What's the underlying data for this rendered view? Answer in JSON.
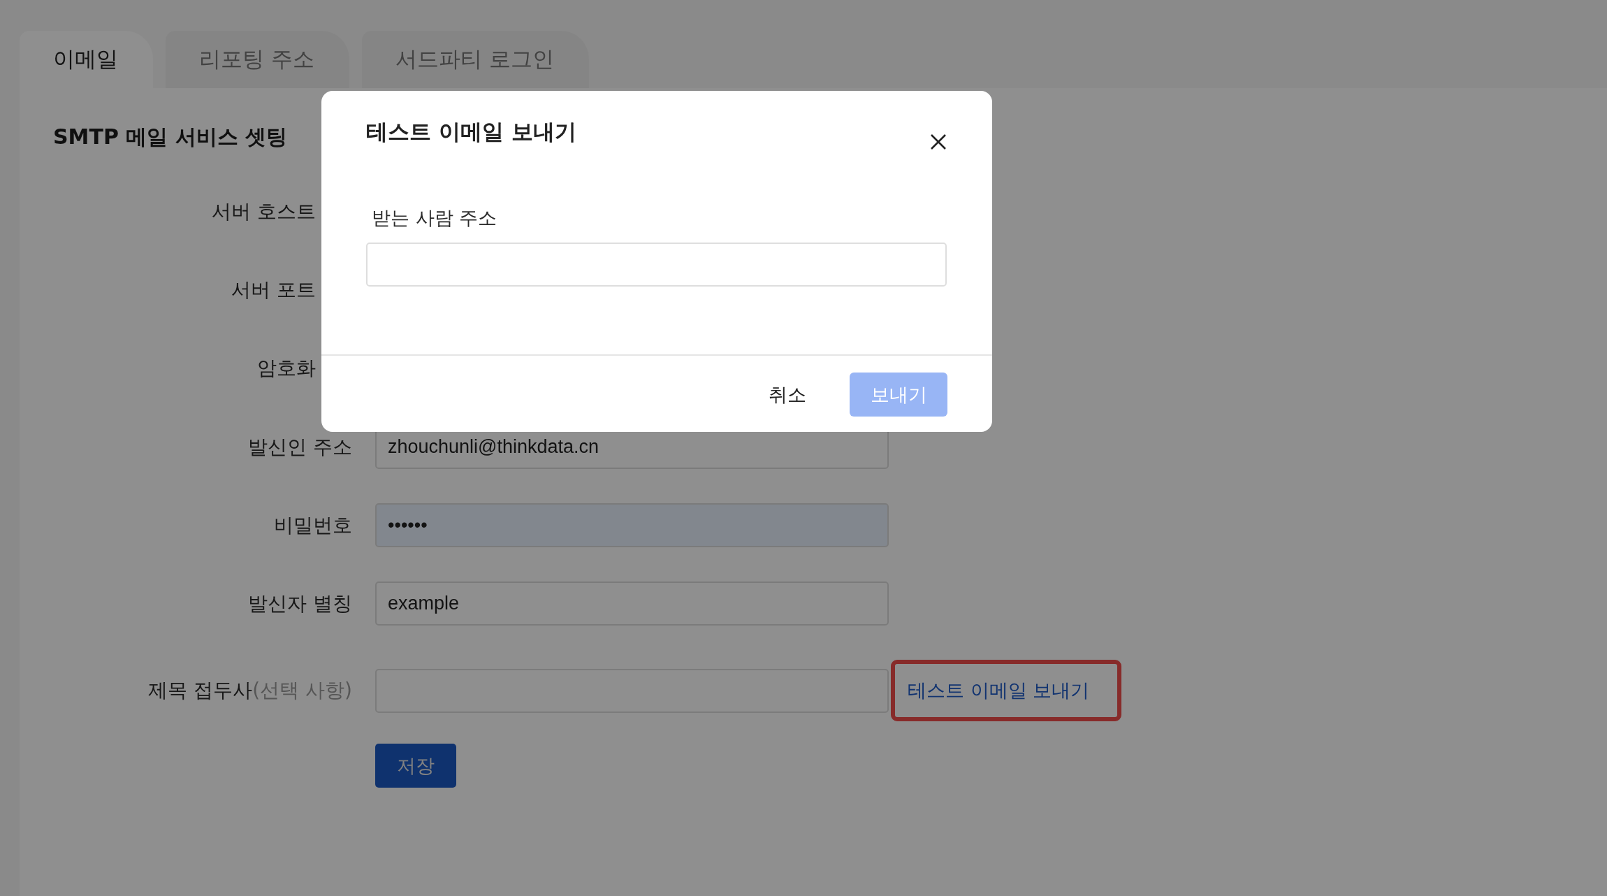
{
  "tabs": [
    {
      "label": "이메일",
      "selected": true
    },
    {
      "label": "리포팅 주소",
      "selected": false
    },
    {
      "label": "서드파티 로그인",
      "selected": false
    }
  ],
  "section_title": "SMTP 메일 서비스 셋팅",
  "fields": [
    {
      "label": "서버 호스트",
      "kind": "covered"
    },
    {
      "label": "서버 포트",
      "kind": "covered"
    },
    {
      "label": "암호화",
      "kind": "covered"
    },
    {
      "label": "발신인 주소",
      "kind": "text",
      "value": "zhouchunli@thinkdata.cn"
    },
    {
      "label": "비밀번호",
      "kind": "password",
      "value": "••••••"
    },
    {
      "label": "발신자 별칭",
      "kind": "text",
      "value": "example"
    },
    {
      "label": "제목 접두사",
      "hint": "(선택 사항)",
      "kind": "text",
      "highlighted": true,
      "link": "테스트 이메일 보내기"
    }
  ],
  "save_button": "저장",
  "dialog": {
    "title": "테스트 이메일 보내기",
    "field_label": "받는 사람 주소",
    "cancel": "취소",
    "send": {
      "label": "보내기",
      "disabled": true
    }
  }
}
